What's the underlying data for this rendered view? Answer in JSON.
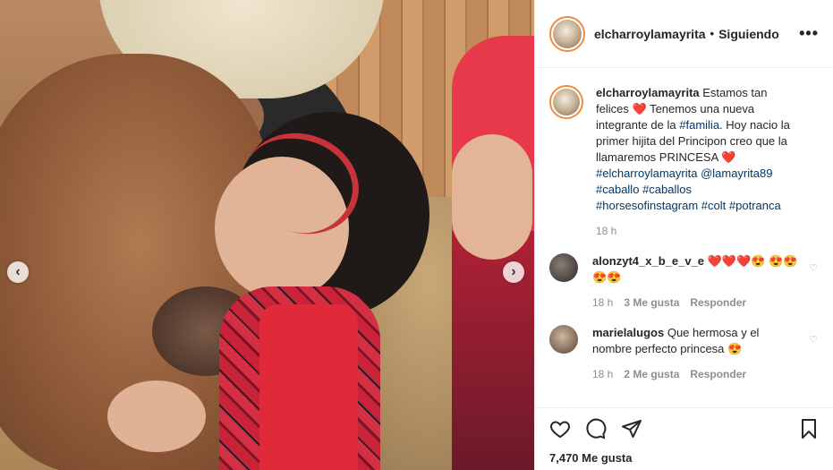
{
  "post": {
    "username": "elcharroylamayrita",
    "follow_status": "Siguiendo",
    "more_icon": "more-options-icon"
  },
  "caption": {
    "username": "elcharroylamayrita",
    "text_1": "Estamos tan felices",
    "text_2": "Tenemos una nueva integrante de la",
    "tag_familia": "#familia",
    "text_3": ". Hoy nacio la primer hijita del Principon creo que la llamaremos PRINCESA",
    "mention_1": "#elcharroylamayrita",
    "mention_2": "@lamayrita89",
    "tags_line_1a": "#caballo",
    "tags_line_1b": "#caballos",
    "tags_line_2a": "#horsesofinstagram",
    "tags_line_2b": "#colt",
    "tags_line_2c": "#potranca",
    "time": "18 h"
  },
  "comments": [
    {
      "username": "alonzyt4_x_b_e_v_e",
      "text": "❤️❤️❤️😍 😍😍😍😍",
      "time": "18 h",
      "likes": "3 Me gusta",
      "reply": "Responder"
    },
    {
      "username": "marielalugos",
      "text": "Que hermosa y el nombre perfecto princesa 😍",
      "time": "18 h",
      "likes": "2 Me gusta",
      "reply": "Responder"
    }
  ],
  "nav": {
    "prev": "‹",
    "next": "›"
  },
  "actions": {
    "like_icon": "heart-icon",
    "comment_icon": "comment-icon",
    "share_icon": "share-icon",
    "save_icon": "bookmark-icon",
    "likes_count": "7,470 Me gusta"
  },
  "colors": {
    "accent_ring": "#f18a3e",
    "tag_link": "#00376b",
    "muted": "#8e8e8e",
    "heart": "#ed2d3a"
  }
}
